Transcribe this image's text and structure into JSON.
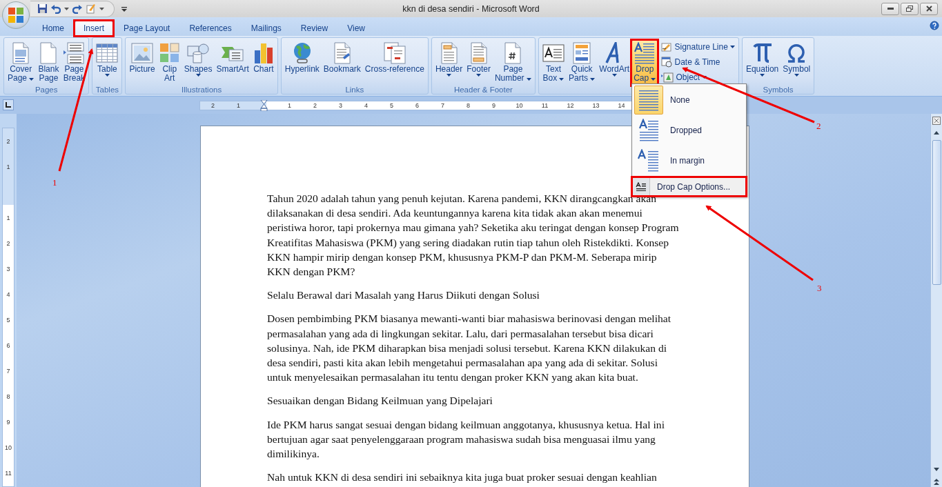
{
  "window": {
    "title": "kkn di desa sendiri - Microsoft Word"
  },
  "tabs": [
    {
      "label": "Home",
      "selected": false
    },
    {
      "label": "Insert",
      "selected": true
    },
    {
      "label": "Page Layout",
      "selected": false
    },
    {
      "label": "References",
      "selected": false
    },
    {
      "label": "Mailings",
      "selected": false
    },
    {
      "label": "Review",
      "selected": false
    },
    {
      "label": "View",
      "selected": false
    }
  ],
  "ribbon": {
    "groups": [
      {
        "label": "Pages",
        "buttons": [
          {
            "kind": "large",
            "lines": [
              "Cover",
              "Page"
            ],
            "dropdown": true,
            "active": false
          },
          {
            "kind": "large",
            "lines": [
              "Blank",
              "Page"
            ],
            "dropdown": false,
            "active": false
          },
          {
            "kind": "large",
            "lines": [
              "Page",
              "Break"
            ],
            "dropdown": false,
            "active": false
          }
        ]
      },
      {
        "label": "Tables",
        "buttons": [
          {
            "kind": "large",
            "lines": [
              "Table"
            ],
            "dropdown": true,
            "active": false
          }
        ]
      },
      {
        "label": "Illustrations",
        "buttons": [
          {
            "kind": "large",
            "lines": [
              "Picture"
            ],
            "dropdown": false,
            "active": false
          },
          {
            "kind": "large",
            "lines": [
              "Clip",
              "Art"
            ],
            "dropdown": false,
            "active": false
          },
          {
            "kind": "large",
            "lines": [
              "Shapes"
            ],
            "dropdown": true,
            "active": false
          },
          {
            "kind": "large",
            "lines": [
              "SmartArt"
            ],
            "dropdown": false,
            "active": false
          },
          {
            "kind": "large",
            "lines": [
              "Chart"
            ],
            "dropdown": false,
            "active": false
          }
        ]
      },
      {
        "label": "Links",
        "buttons": [
          {
            "kind": "large",
            "lines": [
              "Hyperlink"
            ],
            "dropdown": false,
            "active": false
          },
          {
            "kind": "large",
            "lines": [
              "Bookmark"
            ],
            "dropdown": false,
            "active": false
          },
          {
            "kind": "large",
            "lines": [
              "Cross-reference"
            ],
            "dropdown": false,
            "active": false
          }
        ]
      },
      {
        "label": "Header & Footer",
        "buttons": [
          {
            "kind": "large",
            "lines": [
              "Header"
            ],
            "dropdown": true,
            "active": false
          },
          {
            "kind": "large",
            "lines": [
              "Footer"
            ],
            "dropdown": true,
            "active": false
          },
          {
            "kind": "large",
            "lines": [
              "Page",
              "Number"
            ],
            "dropdown": true,
            "active": false
          }
        ]
      },
      {
        "buttons": [
          {
            "kind": "large",
            "lines": [
              "Text",
              "Box"
            ],
            "dropdown": true,
            "active": false
          },
          {
            "kind": "large",
            "lines": [
              "Quick",
              "Parts"
            ],
            "dropdown": true,
            "active": false
          },
          {
            "kind": "large",
            "lines": [
              "WordArt"
            ],
            "dropdown": true,
            "active": false
          },
          {
            "kind": "large",
            "lines": [
              "Drop",
              "Cap"
            ],
            "dropdown": true,
            "active": true
          },
          {
            "kind": "small",
            "lines": [
              "Signature Line"
            ],
            "dropdown": true,
            "active": false
          },
          {
            "kind": "small",
            "lines": [
              "Date & Time"
            ],
            "dropdown": false,
            "active": false
          },
          {
            "kind": "small",
            "lines": [
              "Object"
            ],
            "dropdown": true,
            "active": false
          }
        ]
      },
      {
        "label": "Symbols",
        "buttons": [
          {
            "kind": "large",
            "lines": [
              "Equation"
            ],
            "dropdown": true,
            "active": false
          },
          {
            "kind": "large",
            "lines": [
              "Symbol"
            ],
            "dropdown": true,
            "active": false
          }
        ]
      }
    ]
  },
  "horizontal_ruler": {
    "labels": [
      "2",
      "1",
      "1",
      "2",
      "3",
      "4",
      "5",
      "6",
      "7",
      "8",
      "9",
      "10",
      "11",
      "12",
      "13",
      "14"
    ]
  },
  "vertical_ruler": {
    "labels": [
      "2",
      "1",
      "1",
      "2",
      "3",
      "4",
      "5",
      "6",
      "7",
      "8",
      "9",
      "10",
      "11"
    ]
  },
  "document": {
    "paragraphs": [
      "Tahun 2020 adalah tahun yang penuh kejutan. Karena pandemi, KKN dirangcangkan akan dilaksanakan di desa sendiri. Ada keuntungannya karena kita tidak akan akan menemui peristiwa horor, tapi prokernya mau gimana yah? Seketika aku teringat dengan konsep Program Kreatifitas Mahasiswa (PKM) yang sering diadakan rutin tiap tahun oleh Ristekdikti. Konsep KKN hampir mirip dengan konsep PKM, khususnya PKM-P dan PKM-M. Seberapa mirip KKN dengan PKM?",
      "Selalu Berawal dari Masalah yang Harus Diikuti dengan Solusi",
      "Dosen pembimbing PKM biasanya mewanti-wanti biar mahasiswa berinovasi dengan melihat permasalahan yang ada di lingkungan sekitar. Lalu, dari permasalahan tersebut bisa dicari solusinya. Nah, ide PKM diharapkan bisa menjadi solusi tersebut. Karena KKN dilakukan di desa sendiri, pasti kita akan lebih mengetahui permasalahan apa yang ada di sekitar. Solusi untuk menyelesaikan permasalahan itu tentu dengan proker KKN yang akan kita buat.",
      "Sesuaikan dengan Bidang Keilmuan yang Dipelajari",
      "Ide PKM harus sangat sesuai dengan bidang keilmuan anggotanya, khususnya ketua. Hal ini bertujuan agar saat penyelenggaraan program mahasiswa sudah bisa menguasai ilmu yang dimilikinya.",
      "Nah untuk KKN di desa sendiri ini sebaiknya kita juga buat proker sesuai dengan keahlian"
    ]
  },
  "drop_cap_menu": {
    "items": [
      {
        "label": "None",
        "selected": true
      },
      {
        "label": "Dropped",
        "selected": false
      },
      {
        "label": "In margin",
        "selected": false
      }
    ],
    "footer": "Drop Cap Options..."
  },
  "annotations": [
    {
      "label": "1"
    },
    {
      "label": "2"
    },
    {
      "label": "3"
    }
  ]
}
